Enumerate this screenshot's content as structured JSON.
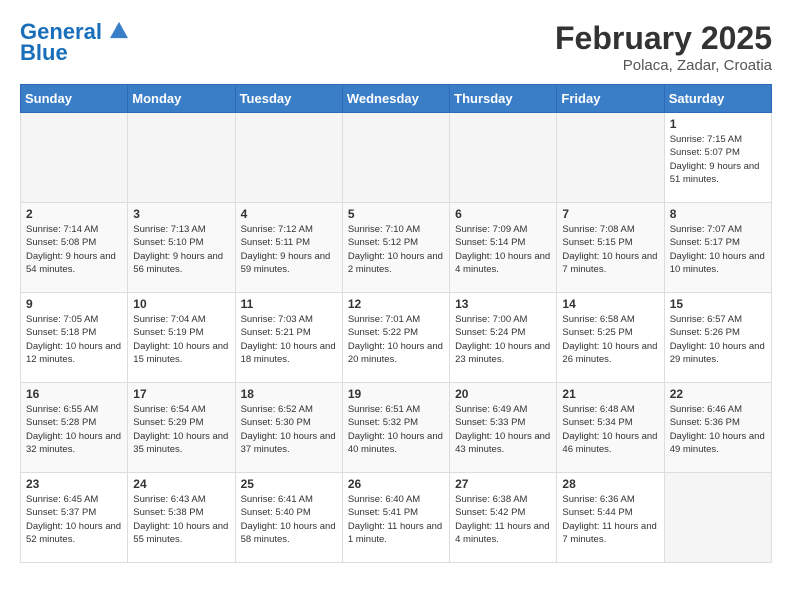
{
  "header": {
    "logo_line1": "General",
    "logo_line2": "Blue",
    "month_title": "February 2025",
    "location": "Polaca, Zadar, Croatia"
  },
  "weekdays": [
    "Sunday",
    "Monday",
    "Tuesday",
    "Wednesday",
    "Thursday",
    "Friday",
    "Saturday"
  ],
  "weeks": [
    [
      {
        "day": "",
        "info": ""
      },
      {
        "day": "",
        "info": ""
      },
      {
        "day": "",
        "info": ""
      },
      {
        "day": "",
        "info": ""
      },
      {
        "day": "",
        "info": ""
      },
      {
        "day": "",
        "info": ""
      },
      {
        "day": "1",
        "info": "Sunrise: 7:15 AM\nSunset: 5:07 PM\nDaylight: 9 hours and 51 minutes."
      }
    ],
    [
      {
        "day": "2",
        "info": "Sunrise: 7:14 AM\nSunset: 5:08 PM\nDaylight: 9 hours and 54 minutes."
      },
      {
        "day": "3",
        "info": "Sunrise: 7:13 AM\nSunset: 5:10 PM\nDaylight: 9 hours and 56 minutes."
      },
      {
        "day": "4",
        "info": "Sunrise: 7:12 AM\nSunset: 5:11 PM\nDaylight: 9 hours and 59 minutes."
      },
      {
        "day": "5",
        "info": "Sunrise: 7:10 AM\nSunset: 5:12 PM\nDaylight: 10 hours and 2 minutes."
      },
      {
        "day": "6",
        "info": "Sunrise: 7:09 AM\nSunset: 5:14 PM\nDaylight: 10 hours and 4 minutes."
      },
      {
        "day": "7",
        "info": "Sunrise: 7:08 AM\nSunset: 5:15 PM\nDaylight: 10 hours and 7 minutes."
      },
      {
        "day": "8",
        "info": "Sunrise: 7:07 AM\nSunset: 5:17 PM\nDaylight: 10 hours and 10 minutes."
      }
    ],
    [
      {
        "day": "9",
        "info": "Sunrise: 7:05 AM\nSunset: 5:18 PM\nDaylight: 10 hours and 12 minutes."
      },
      {
        "day": "10",
        "info": "Sunrise: 7:04 AM\nSunset: 5:19 PM\nDaylight: 10 hours and 15 minutes."
      },
      {
        "day": "11",
        "info": "Sunrise: 7:03 AM\nSunset: 5:21 PM\nDaylight: 10 hours and 18 minutes."
      },
      {
        "day": "12",
        "info": "Sunrise: 7:01 AM\nSunset: 5:22 PM\nDaylight: 10 hours and 20 minutes."
      },
      {
        "day": "13",
        "info": "Sunrise: 7:00 AM\nSunset: 5:24 PM\nDaylight: 10 hours and 23 minutes."
      },
      {
        "day": "14",
        "info": "Sunrise: 6:58 AM\nSunset: 5:25 PM\nDaylight: 10 hours and 26 minutes."
      },
      {
        "day": "15",
        "info": "Sunrise: 6:57 AM\nSunset: 5:26 PM\nDaylight: 10 hours and 29 minutes."
      }
    ],
    [
      {
        "day": "16",
        "info": "Sunrise: 6:55 AM\nSunset: 5:28 PM\nDaylight: 10 hours and 32 minutes."
      },
      {
        "day": "17",
        "info": "Sunrise: 6:54 AM\nSunset: 5:29 PM\nDaylight: 10 hours and 35 minutes."
      },
      {
        "day": "18",
        "info": "Sunrise: 6:52 AM\nSunset: 5:30 PM\nDaylight: 10 hours and 37 minutes."
      },
      {
        "day": "19",
        "info": "Sunrise: 6:51 AM\nSunset: 5:32 PM\nDaylight: 10 hours and 40 minutes."
      },
      {
        "day": "20",
        "info": "Sunrise: 6:49 AM\nSunset: 5:33 PM\nDaylight: 10 hours and 43 minutes."
      },
      {
        "day": "21",
        "info": "Sunrise: 6:48 AM\nSunset: 5:34 PM\nDaylight: 10 hours and 46 minutes."
      },
      {
        "day": "22",
        "info": "Sunrise: 6:46 AM\nSunset: 5:36 PM\nDaylight: 10 hours and 49 minutes."
      }
    ],
    [
      {
        "day": "23",
        "info": "Sunrise: 6:45 AM\nSunset: 5:37 PM\nDaylight: 10 hours and 52 minutes."
      },
      {
        "day": "24",
        "info": "Sunrise: 6:43 AM\nSunset: 5:38 PM\nDaylight: 10 hours and 55 minutes."
      },
      {
        "day": "25",
        "info": "Sunrise: 6:41 AM\nSunset: 5:40 PM\nDaylight: 10 hours and 58 minutes."
      },
      {
        "day": "26",
        "info": "Sunrise: 6:40 AM\nSunset: 5:41 PM\nDaylight: 11 hours and 1 minute."
      },
      {
        "day": "27",
        "info": "Sunrise: 6:38 AM\nSunset: 5:42 PM\nDaylight: 11 hours and 4 minutes."
      },
      {
        "day": "28",
        "info": "Sunrise: 6:36 AM\nSunset: 5:44 PM\nDaylight: 11 hours and 7 minutes."
      },
      {
        "day": "",
        "info": ""
      }
    ]
  ]
}
